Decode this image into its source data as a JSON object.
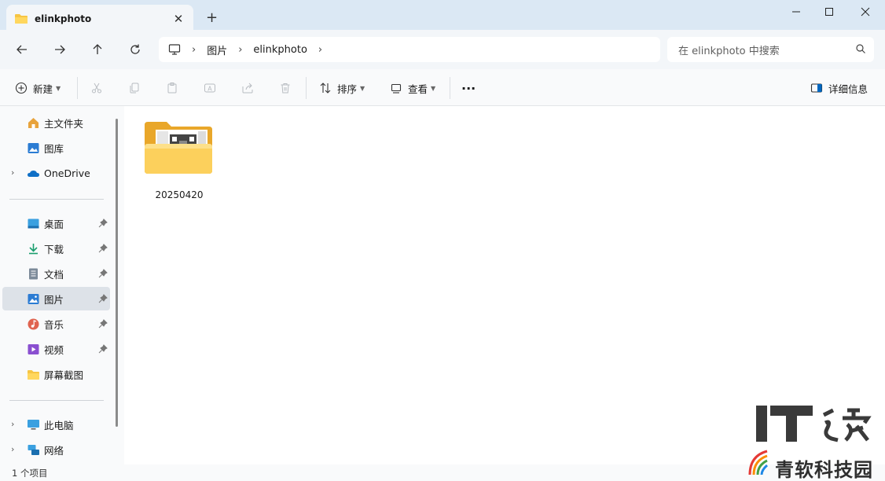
{
  "window": {
    "tab_title": "elinkphoto",
    "new_tab": "+",
    "close_tab": "✕"
  },
  "address": {
    "crumbs": [
      "图片",
      "elinkphoto"
    ],
    "search_placeholder": "在 elinkphoto 中搜索"
  },
  "toolbar": {
    "new_label": "新建",
    "sort_label": "排序",
    "view_label": "查看",
    "more_label": "···",
    "details_label": "详细信息"
  },
  "sidebar": {
    "items": [
      {
        "label": "主文件夹",
        "icon": "home-icon"
      },
      {
        "label": "图库",
        "icon": "gallery-icon"
      },
      {
        "label": "OneDrive",
        "icon": "cloud-icon"
      },
      {
        "label": "桌面",
        "icon": "desktop-icon"
      },
      {
        "label": "下载",
        "icon": "download-icon"
      },
      {
        "label": "文档",
        "icon": "document-icon"
      },
      {
        "label": "图片",
        "icon": "pictures-icon"
      },
      {
        "label": "音乐",
        "icon": "music-icon"
      },
      {
        "label": "视频",
        "icon": "video-icon"
      },
      {
        "label": "屏幕截图",
        "icon": "folder-icon"
      },
      {
        "label": "此电脑",
        "icon": "pc-icon"
      },
      {
        "label": "网络",
        "icon": "network-icon"
      }
    ]
  },
  "content": {
    "items": [
      {
        "name": "20250420",
        "type": "folder"
      }
    ]
  },
  "status": {
    "text": "1 个项目"
  },
  "watermark": {
    "line1": "IT之家",
    "line2": "青软科技园"
  },
  "colors": {
    "folder": "#f6c544",
    "accent": "#0067c0",
    "selected": "#dde2e8"
  }
}
